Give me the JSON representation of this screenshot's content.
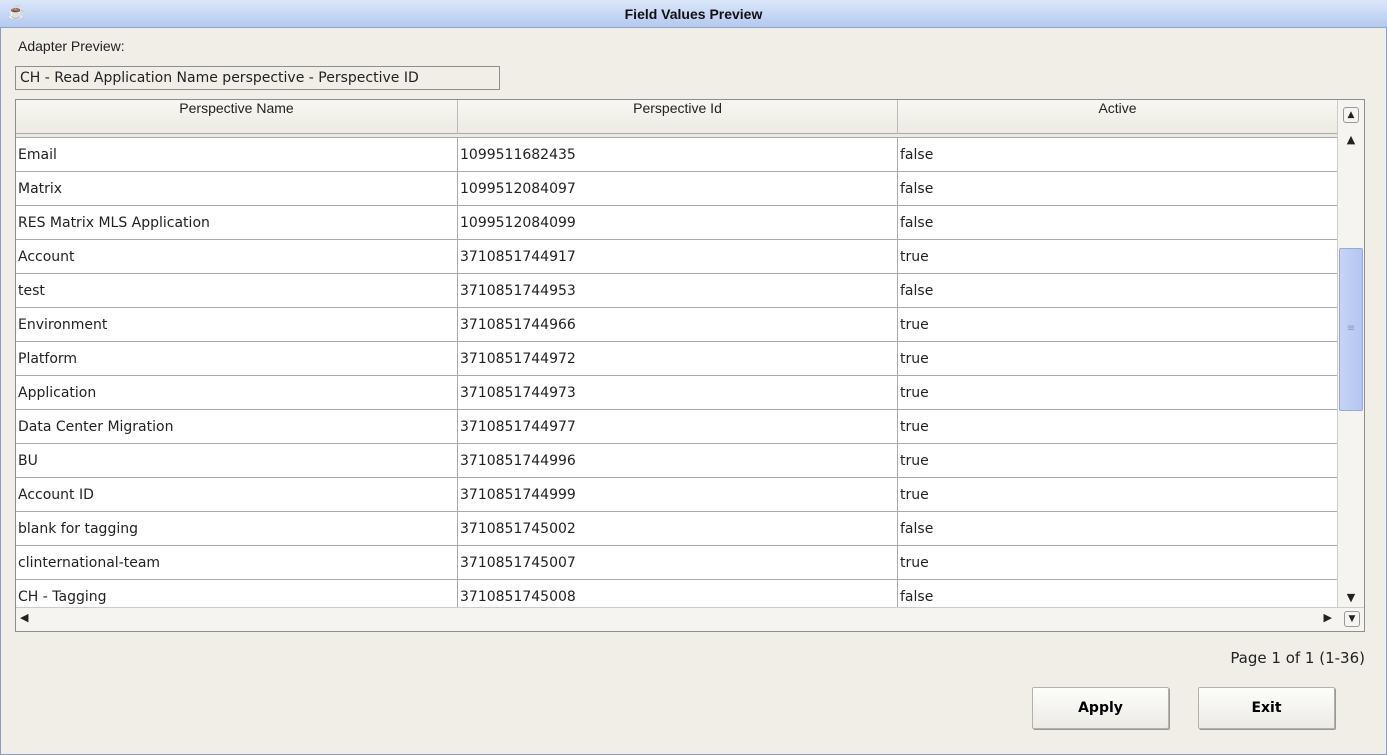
{
  "window": {
    "title": "Field Values Preview",
    "icon": "java-cup-icon"
  },
  "adapter": {
    "label": "Adapter Preview:",
    "value": "CH - Read Application Name perspective - Perspective ID"
  },
  "table": {
    "columns": [
      "Perspective Name",
      "Perspective Id",
      "Active"
    ],
    "rows": [
      [
        "Email",
        "1099511682435",
        "false"
      ],
      [
        "Matrix",
        "1099512084097",
        "false"
      ],
      [
        "RES Matrix MLS Application",
        "1099512084099",
        "false"
      ],
      [
        "Account",
        "3710851744917",
        "true"
      ],
      [
        "test",
        "3710851744953",
        "false"
      ],
      [
        "Environment",
        "3710851744966",
        "true"
      ],
      [
        "Platform",
        "3710851744972",
        "true"
      ],
      [
        "Application",
        "3710851744973",
        "true"
      ],
      [
        "Data Center Migration",
        "3710851744977",
        "true"
      ],
      [
        "BU",
        "3710851744996",
        "true"
      ],
      [
        "Account ID",
        "3710851744999",
        "true"
      ],
      [
        "blank for tagging",
        "3710851745002",
        "false"
      ],
      [
        "clinternational-team",
        "3710851745007",
        "true"
      ],
      [
        "CH - Tagging",
        "3710851745008",
        "false"
      ]
    ]
  },
  "pagination": {
    "text": "Page 1 of 1 (1-36)"
  },
  "buttons": {
    "apply": "Apply",
    "exit": "Exit"
  }
}
